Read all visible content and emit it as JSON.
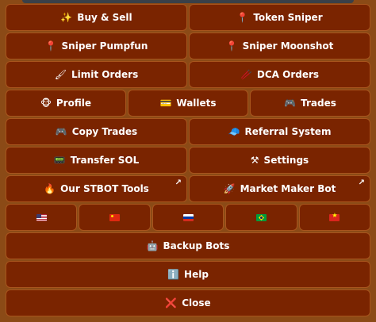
{
  "keyboard": {
    "buy_sell": {
      "icon": "✨",
      "label": "Buy & Sell"
    },
    "token_sniper": {
      "icon": "📍",
      "label": "Token Sniper"
    },
    "sniper_pumpfun": {
      "icon": "📍",
      "label": "Sniper Pumpfun"
    },
    "sniper_moonshot": {
      "icon": "📍",
      "label": "Sniper Moonshot"
    },
    "limit_orders": {
      "icon": "🖌",
      "label": "Limit Orders"
    },
    "dca_orders": {
      "icon": "🥢",
      "label": "DCA Orders"
    },
    "profile": {
      "icon": "🐵",
      "label": "Profile"
    },
    "wallets": {
      "icon": "💳",
      "label": "Wallets"
    },
    "trades": {
      "icon": "🎮",
      "label": "Trades"
    },
    "copy_trades": {
      "icon": "🎮",
      "label": "Copy Trades"
    },
    "referral_system": {
      "icon": "🧢",
      "label": "Referral System"
    },
    "transfer_sol": {
      "icon": "📟",
      "label": "Transfer SOL"
    },
    "settings": {
      "icon": "⚒",
      "label": "Settings"
    },
    "our_stbot_tools": {
      "icon": "🔥",
      "label": "Our STBOT Tools",
      "external_icon": "↗"
    },
    "market_maker_bot": {
      "icon": "🚀",
      "label": "Market Maker Bot",
      "external_icon": "↗"
    },
    "languages": [
      {
        "icon": "us-flag-icon"
      },
      {
        "icon": "china-flag-icon"
      },
      {
        "icon": "russia-flag-icon"
      },
      {
        "icon": "brazil-flag-icon"
      },
      {
        "icon": "vietnam-flag-icon"
      }
    ],
    "backup_bots": {
      "icon": "🤖",
      "label": "Backup Bots"
    },
    "help": {
      "icon": "ℹ️",
      "label": "Help"
    },
    "close": {
      "icon": "❌",
      "label": "Close"
    }
  },
  "colors": {
    "background": "#8b4a16",
    "button": "#7a2400",
    "button_border": "#a8551d",
    "text": "#ffffff"
  }
}
